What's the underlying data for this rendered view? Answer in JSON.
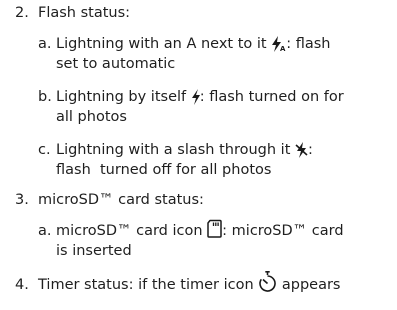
{
  "items": {
    "flash": {
      "num": "2.",
      "title": "Flash status:",
      "a": {
        "letter": "a.",
        "line1_pre": "Lightning with an A next to it",
        "line1_post": ": flash",
        "line2": "set to automatic",
        "icon": "flash-auto-icon"
      },
      "b": {
        "letter": "b.",
        "line1_pre": "Lightning by itself",
        "line1_post": ": flash turned on for",
        "line2": "all photos",
        "icon": "flash-on-icon"
      },
      "c": {
        "letter": "c.",
        "line1_pre": "Lightning with a slash through it",
        "line1_post": ":",
        "line2": "flash  turned off for all photos",
        "icon": "flash-off-icon"
      }
    },
    "sd": {
      "num": "3.",
      "title": "microSD™ card status:",
      "a": {
        "letter": "a.",
        "line1_pre": "microSD™ card icon",
        "line1_post": ": microSD™ card",
        "line2": "is inserted",
        "icon": "sd-card-icon"
      }
    },
    "timer": {
      "num": "4.",
      "text_pre": "Timer status: if the timer icon",
      "text_post": "appears",
      "icon": "timer-icon"
    }
  }
}
